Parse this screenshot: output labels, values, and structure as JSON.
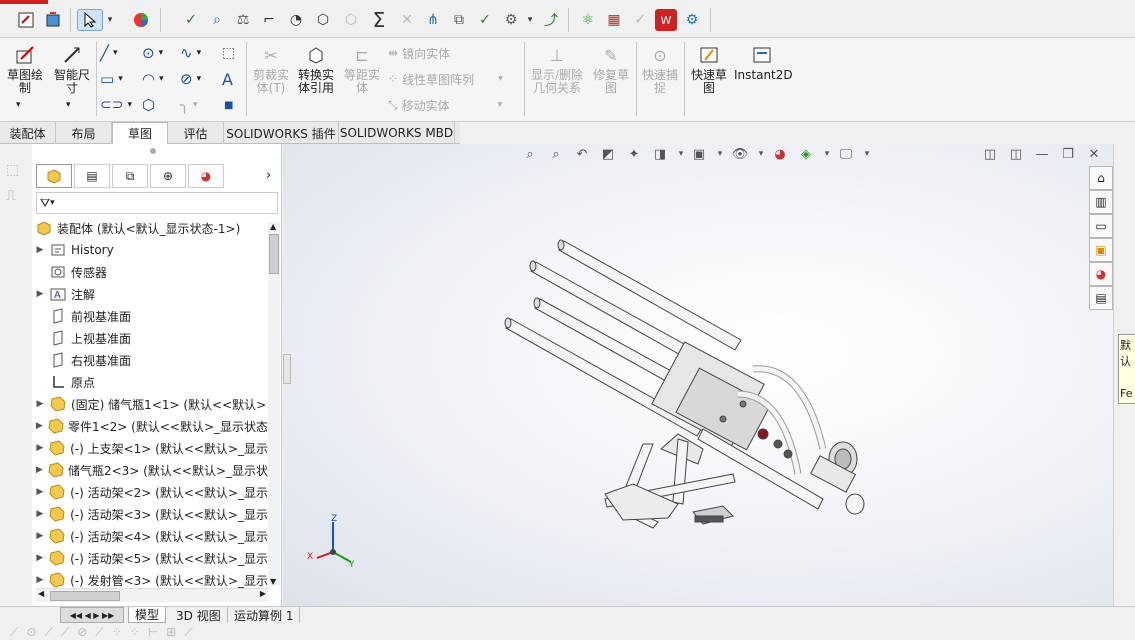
{
  "ribbon": {
    "sketch": "草图绘\n制",
    "smart_dim": "智能尺\n寸",
    "trim": "剪裁实\n体(T)",
    "convert": "转换实\n体引用",
    "offset": "等距实\n体",
    "mirror": "镜向实体",
    "linear_pattern": "线性草图阵列",
    "move": "移动实体",
    "show_relations": "显示/删除\n几何关系",
    "repair": "修复草\n图",
    "rapid_snap": "快速捕\n捉",
    "rapid_sketch": "快速草\n图",
    "instant2d": "Instant2D"
  },
  "tabs": [
    {
      "label": "装配体"
    },
    {
      "label": "布局"
    },
    {
      "label": "草图"
    },
    {
      "label": "评估"
    },
    {
      "label": "SOLIDWORKS 插件"
    },
    {
      "label": "SOLIDWORKS MBD"
    }
  ],
  "tree": {
    "root": "装配体 (默认<默认_显示状态-1>)",
    "items": [
      {
        "label": "History",
        "type": "history",
        "expand": true
      },
      {
        "label": "传感器",
        "type": "sensor",
        "expand": false
      },
      {
        "label": "注解",
        "type": "annotation",
        "expand": true
      },
      {
        "label": "前视基准面",
        "type": "plane",
        "expand": false
      },
      {
        "label": "上视基准面",
        "type": "plane",
        "expand": false
      },
      {
        "label": "右视基准面",
        "type": "plane",
        "expand": false
      },
      {
        "label": "原点",
        "type": "origin",
        "expand": false
      },
      {
        "label": "(固定) 储气瓶1<1> (默认<<默认>",
        "type": "part",
        "expand": true
      },
      {
        "label": "零件1<2> (默认<<默认>_显示状态",
        "type": "part",
        "expand": true
      },
      {
        "label": "(-) 上支架<1> (默认<<默认>_显示",
        "type": "part",
        "expand": true
      },
      {
        "label": "储气瓶2<3> (默认<<默认>_显示状",
        "type": "part",
        "expand": true
      },
      {
        "label": "(-) 活动架<2> (默认<<默认>_显示",
        "type": "part",
        "expand": true
      },
      {
        "label": "(-) 活动架<3> (默认<<默认>_显示",
        "type": "part",
        "expand": true
      },
      {
        "label": "(-) 活动架<4> (默认<<默认>_显示",
        "type": "part",
        "expand": true
      },
      {
        "label": "(-) 活动架<5> (默认<<默认>_显示",
        "type": "part",
        "expand": true
      },
      {
        "label": "(-) 发射管<3> (默认<<默认>_显示",
        "type": "part",
        "expand": true
      }
    ]
  },
  "bottom_tabs": [
    {
      "label": "模型"
    },
    {
      "label": "3D 视图"
    },
    {
      "label": "运动算例 1"
    }
  ],
  "triad": {
    "x": "X",
    "y": "Y",
    "z": "Z"
  },
  "right_popup": {
    "line1": "默认",
    "line2": "Fe"
  },
  "colors": {
    "accent": "#1f5fa6",
    "part_icon": "#f2c94c",
    "popup_bg": "#ffffe1"
  }
}
